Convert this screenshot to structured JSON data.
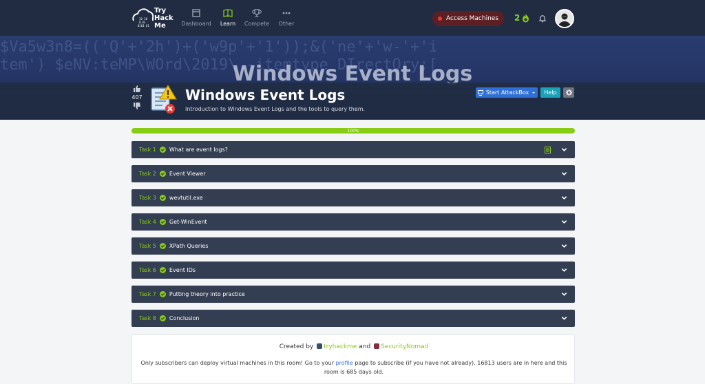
{
  "nav": {
    "logo_text": [
      "Try",
      "Hack",
      "Me"
    ],
    "items": [
      {
        "label": "Dashboard",
        "icon": "dashboard-icon",
        "active": false
      },
      {
        "label": "Learn",
        "icon": "book-icon",
        "active": true
      },
      {
        "label": "Compete",
        "icon": "trophy-icon",
        "active": false
      },
      {
        "label": "Other",
        "icon": "dots-icon",
        "active": false
      }
    ],
    "access_label": "Access Machines",
    "streak": "2"
  },
  "room": {
    "banner_title": "Windows Event Logs",
    "banner_code": "$Va5w3n8=(('Q'+'2h')+('w9p'+'1'));&('ne'+'w-'+'i\ntem') $eNV:teMP\\WOrd\\2019\\ -itemtype DIrectOry;[",
    "votes": "407",
    "title": "Windows Event Logs",
    "description": "Introduction to Windows Event Logs and the tools to query them.",
    "attackbox_label": "Start AttackBox",
    "help_label": "Help"
  },
  "progress": {
    "value": 1.0,
    "label": "100%"
  },
  "tasks": [
    {
      "num": "Task 1",
      "title": "What are event logs?"
    },
    {
      "num": "Task 2",
      "title": "Event Viewer"
    },
    {
      "num": "Task 3",
      "title": "wevtutil.exe"
    },
    {
      "num": "Task 4",
      "title": "Get-WinEvent"
    },
    {
      "num": "Task 5",
      "title": "XPath Queries"
    },
    {
      "num": "Task 6",
      "title": "Event IDs"
    },
    {
      "num": "Task 7",
      "title": "Putting theory into practice"
    },
    {
      "num": "Task 8",
      "title": "Conclusion"
    }
  ],
  "footer": {
    "created_by": "Created by",
    "author1": "tryhackme",
    "and": "and",
    "author2": "SecurityNomad",
    "notice_pre": "Only subscribers can deploy virtual machines in this room! Go to your",
    "notice_link": "profile",
    "notice_post": "page to subscribe (if you have not already). 16813 users are in here and this room is 685 days old."
  },
  "colors": {
    "accent": "#88cc14",
    "nav_bg": "#212c42",
    "task_bg": "#343e52",
    "primary": "#2f6fd6"
  }
}
